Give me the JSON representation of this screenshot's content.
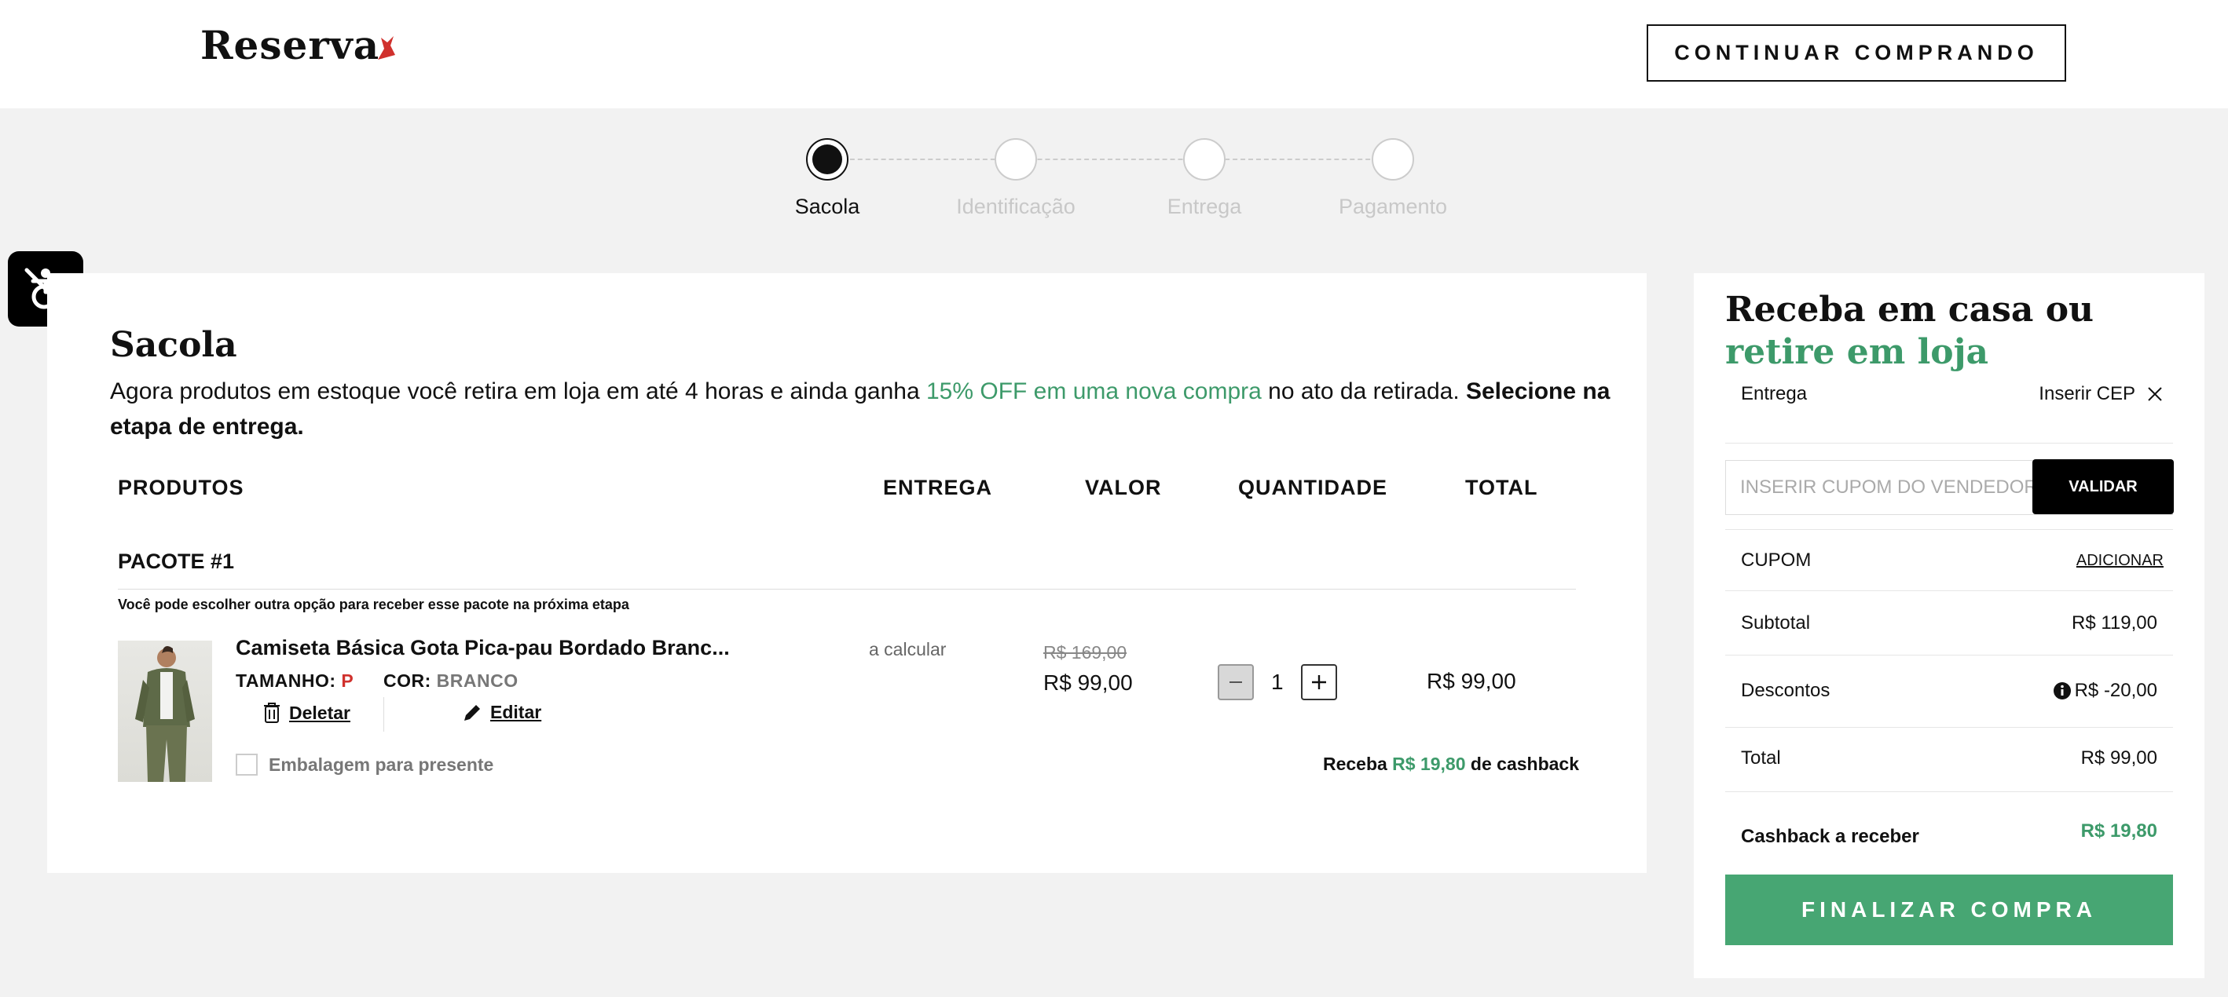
{
  "header": {
    "logo": "Reserva",
    "continue_button": "CONTINUAR COMPRANDO"
  },
  "steps": [
    {
      "label": "Sacola",
      "active": true
    },
    {
      "label": "Identificação",
      "active": false
    },
    {
      "label": "Entrega",
      "active": false
    },
    {
      "label": "Pagamento",
      "active": false
    }
  ],
  "cart": {
    "title": "Sacola",
    "intro_1": "Agora produtos em estoque você retira em loja em até 4 horas e ainda ganha ",
    "intro_highlight": "15% OFF em uma nova compra",
    "intro_2": " no ato da retirada. ",
    "intro_bold": "Selecione na etapa de entrega.",
    "columns": {
      "products": "PRODUTOS",
      "delivery": "ENTREGA",
      "value": "VALOR",
      "quantity": "QUANTIDADE",
      "total": "TOTAL"
    },
    "package_title": "PACOTE #1",
    "package_note": "Você pode escolher outra opção para receber esse pacote na próxima etapa",
    "item": {
      "name": "Camiseta Básica Gota Pica-pau Bordado Branc...",
      "size_label": "TAMANHO:",
      "size_value": "P",
      "color_label": "COR:",
      "color_value": "BRANCO",
      "delete_label": "Deletar",
      "edit_label": "Editar",
      "gift_label": "Embalagem para presente",
      "delivery": "a calcular",
      "old_price": "R$ 169,00",
      "price": "R$ 99,00",
      "quantity": "1",
      "total": "R$ 99,00",
      "cashback_prefix": "Receba ",
      "cashback_value": "R$ 19,80",
      "cashback_suffix": " de cashback"
    }
  },
  "summary": {
    "title_line1": "Receba em casa ou",
    "title_line2": "retire em loja",
    "delivery_label": "Entrega",
    "cep_label": "Inserir CEP",
    "coupon_placeholder": "INSERIR CUPOM DO VENDEDOR(A)",
    "validate_button": "VALIDAR",
    "coupon_label": "CUPOM",
    "coupon_add": "ADICIONAR",
    "subtotal_label": "Subtotal",
    "subtotal_value": "R$ 119,00",
    "discount_label": "Descontos",
    "discount_value": "R$ -20,00",
    "total_label": "Total",
    "total_value": "R$ 99,00",
    "cashback_label": "Cashback a receber",
    "cashback_value": "R$ 19,80",
    "finalize_button": "FINALIZAR COMPRA"
  },
  "colors": {
    "accent_green": "#47a673",
    "text_green": "#3d9a6a",
    "size_red": "#d0312d"
  }
}
